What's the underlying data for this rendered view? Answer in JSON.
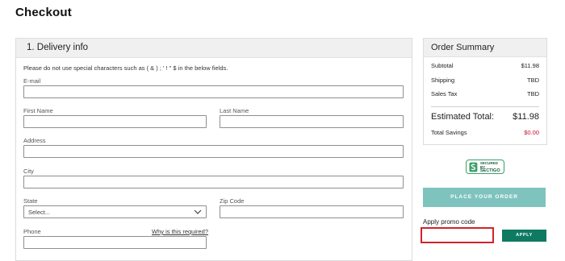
{
  "page": {
    "title": "Checkout"
  },
  "delivery": {
    "heading": "1. Delivery info",
    "note": "Please do not use special characters such as ( & ) ; ' ! \" $ in the below fields.",
    "fields": {
      "email": {
        "label": "E-mail",
        "value": ""
      },
      "first_name": {
        "label": "First Name",
        "value": ""
      },
      "last_name": {
        "label": "Last Name",
        "value": ""
      },
      "address": {
        "label": "Address",
        "value": ""
      },
      "city": {
        "label": "City",
        "value": ""
      },
      "state": {
        "label": "State",
        "selected": "Select..."
      },
      "zip": {
        "label": "Zip Code",
        "value": ""
      },
      "phone": {
        "label": "Phone",
        "value": "",
        "help_link": "Why is this required?"
      }
    }
  },
  "summary": {
    "heading": "Order Summary",
    "subtotal": {
      "label": "Subtotal",
      "value": "$11.98"
    },
    "shipping": {
      "label": "Shipping",
      "value": "TBD"
    },
    "tax": {
      "label": "Sales Tax",
      "value": "TBD"
    },
    "total": {
      "label": "Estimated Total:",
      "value": "$11.98"
    },
    "savings": {
      "label": "Total Savings",
      "value": "$0.00",
      "color": "#c8102e"
    }
  },
  "badge": {
    "line1": "SECURED BY",
    "line2": "SECTIGO",
    "color": "#3aa06a"
  },
  "actions": {
    "place_order": "PLACE YOUR ORDER",
    "promo_label": "Apply promo code",
    "promo_value": "",
    "apply": "APPLY"
  },
  "colors": {
    "place_order_bg": "#7fc3bf",
    "apply_bg": "#0e7a62",
    "promo_border": "#d2232a"
  }
}
